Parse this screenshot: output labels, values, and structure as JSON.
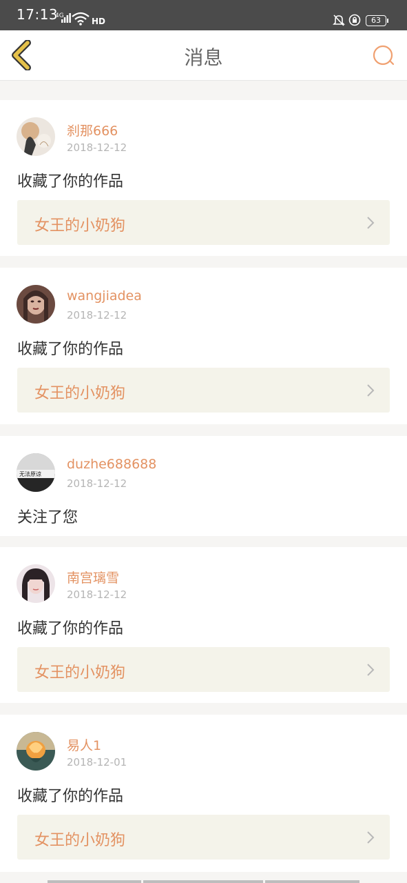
{
  "status_bar": {
    "time": "17:13",
    "network": "4G",
    "hd": "HD",
    "battery": "63"
  },
  "navbar": {
    "title": "消息"
  },
  "notifications": [
    {
      "username": "刹那666",
      "date": "2018-12-12",
      "action": "收藏了你的作品",
      "work": "女王的小奶狗"
    },
    {
      "username": "wangjiadea",
      "date": "2018-12-12",
      "action": "收藏了你的作品",
      "work": "女王的小奶狗"
    },
    {
      "username": "duzhe688688",
      "date": "2018-12-12",
      "action": "关注了您",
      "avatar_caption": "无法原谅"
    },
    {
      "username": "南宫璃雪",
      "date": "2018-12-12",
      "action": "收藏了你的作品",
      "work": "女王的小奶狗"
    },
    {
      "username": "易人1",
      "date": "2018-12-01",
      "action": "收藏了你的作品",
      "work": "女王的小奶狗"
    }
  ],
  "colors": {
    "accent": "#e39262",
    "back_icon": "#e5c14a",
    "work_bg": "#f4f3ea",
    "page_bg": "#f6f5f3"
  }
}
